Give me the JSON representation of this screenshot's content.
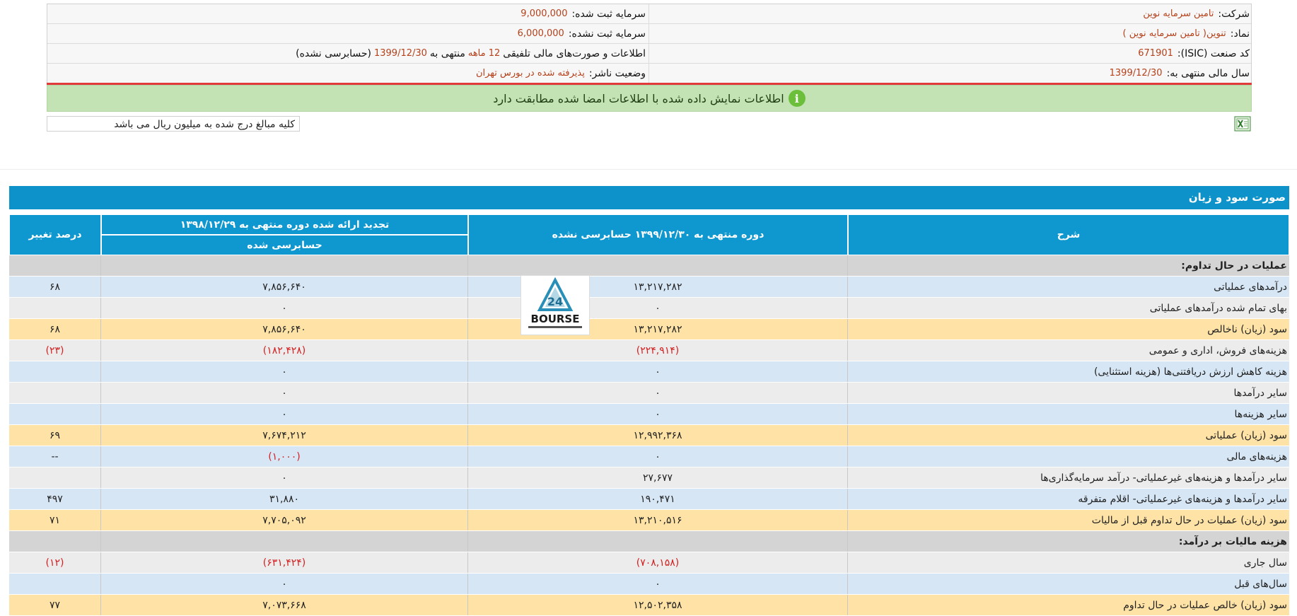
{
  "info": {
    "company_label": "شرکت:",
    "company_value": "تامین سرمایه نوین",
    "capital_registered_label": "سرمایه ثبت شده:",
    "capital_registered_value": "9,000,000",
    "symbol_label": "نماد:",
    "symbol_value": "تنوین( تامین سرمایه نوین )",
    "capital_unregistered_label": "سرمایه ثبت نشده:",
    "capital_unregistered_value": "6,000,000",
    "isic_label": "کد صنعت (ISIC):",
    "isic_value": "671901",
    "statement_prefix": "اطلاعات و صورت‌های مالی تلفیقی",
    "statement_period": "12 ماهه",
    "statement_mid": "منتهی به",
    "statement_date": "1399/12/30",
    "statement_suffix": "(حسابرسی نشده)",
    "fiscal_year_label": "سال مالی منتهی به:",
    "fiscal_year_value": "1399/12/30",
    "publisher_label": "وضعیت ناشر:",
    "publisher_value": "پذیرفته شده در بورس تهران"
  },
  "banner": {
    "icon": "i",
    "text": "اطلاعات نمایش داده شده با اطلاعات امضا شده مطابقت دارد"
  },
  "units_note": "کلیه مبالغ درج شده به میلیون ریال می باشد",
  "section_title": "صورت سود و زیان",
  "table": {
    "headers": {
      "desc": "شرح",
      "current": "دوره منتهی به ۱۳۹۹/۱۲/۳۰ حسابرسی نشده",
      "previous": "تجدید ارائه شده دوره منتهی به ۱۳۹۸/۱۲/۲۹",
      "previous_sub": "حسابرسی شده",
      "change": "درصد تغییر"
    },
    "rows": [
      {
        "style": "header",
        "desc": "عملیات در حال تداوم:",
        "current": "",
        "previous": "",
        "change": ""
      },
      {
        "style": "blue",
        "desc": "درآمدهای عملیاتی",
        "current": "۱۳,۲۱۷,۲۸۲",
        "previous": "۷,۸۵۶,۶۴۰",
        "change": "۶۸"
      },
      {
        "style": "gray",
        "desc": "بهای تمام شده درآمدهای عملیاتی",
        "current": "۰",
        "previous": "۰",
        "change": ""
      },
      {
        "style": "orange",
        "desc": "سود (زیان) ناخالص",
        "current": "۱۳,۲۱۷,۲۸۲",
        "previous": "۷,۸۵۶,۶۴۰",
        "change": "۶۸"
      },
      {
        "style": "gray",
        "desc": "هزینه‌های فروش، اداری و عمومی",
        "current": "(۲۲۴,۹۱۴)",
        "previous": "(۱۸۲,۴۲۸)",
        "change": "(۲۳)",
        "neg": true
      },
      {
        "style": "blue",
        "desc": "هزینه کاهش ارزش دریافتنی‌ها (هزینه استثنایی)",
        "current": "۰",
        "previous": "۰",
        "change": ""
      },
      {
        "style": "gray",
        "desc": "سایر درآمدها",
        "current": "۰",
        "previous": "۰",
        "change": ""
      },
      {
        "style": "blue",
        "desc": "سایر هزینه‌ها",
        "current": "۰",
        "previous": "۰",
        "change": ""
      },
      {
        "style": "orange",
        "desc": "سود (زیان) عملیاتی",
        "current": "۱۲,۹۹۲,۳۶۸",
        "previous": "۷,۶۷۴,۲۱۲",
        "change": "۶۹"
      },
      {
        "style": "blue",
        "desc": "هزینه‌های مالی",
        "current": "۰",
        "previous": "(۱,۰۰۰)",
        "change": "--",
        "neg_prev": true
      },
      {
        "style": "gray",
        "desc": "سایر درآمدها و هزینه‌های غیرعملیاتی- درآمد سرمایه‌گذاری‌ها",
        "current": "۲۷,۶۷۷",
        "previous": "۰",
        "change": ""
      },
      {
        "style": "blue",
        "desc": "سایر درآمدها و هزینه‌های غیرعملیاتی- اقلام متفرقه",
        "current": "۱۹۰,۴۷۱",
        "previous": "۳۱,۸۸۰",
        "change": "۴۹۷"
      },
      {
        "style": "orange",
        "desc": "سود (زیان) عملیات در حال تداوم قبل از مالیات",
        "current": "۱۳,۲۱۰,۵۱۶",
        "previous": "۷,۷۰۵,۰۹۲",
        "change": "۷۱"
      },
      {
        "style": "header",
        "desc": "هزینه مالیات بر درآمد:",
        "current": "",
        "previous": "",
        "change": ""
      },
      {
        "style": "gray",
        "desc": "سال جاری",
        "current": "(۷۰۸,۱۵۸)",
        "previous": "(۶۳۱,۴۲۴)",
        "change": "(۱۲)",
        "neg": true
      },
      {
        "style": "blue",
        "desc": "سال‌های قبل",
        "current": "۰",
        "previous": "۰",
        "change": ""
      },
      {
        "style": "orange",
        "desc": "سود (زیان) خالص عملیات در حال تداوم",
        "current": "۱۲,۵۰۲,۳۵۸",
        "previous": "۷,۰۷۳,۶۶۸",
        "change": "۷۷"
      }
    ]
  },
  "logo": {
    "text": "BOURSE",
    "numeral": "24"
  },
  "colors": {
    "accent": "#0f97cf",
    "negative": "#d42020",
    "banner_bg": "#c3e3b4"
  }
}
